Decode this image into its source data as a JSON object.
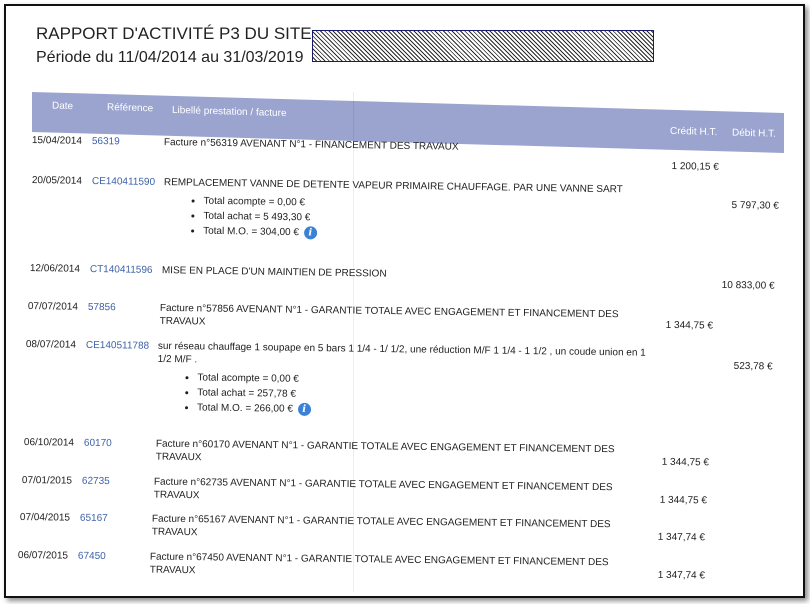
{
  "report": {
    "title": "RAPPORT D'ACTIVITÉ P3 DU SITE",
    "period": "Période du 11/04/2014 au 31/03/2019"
  },
  "columns": {
    "date": "Date",
    "reference": "Référence",
    "libelle": "Libellé prestation / facture",
    "credit": "Crédit H.T.",
    "debit": "Débit H.T."
  },
  "rows": [
    {
      "date": "15/04/2014",
      "ref": "56319",
      "desc": "Facture n°56319 AVENANT N°1 - FINANCEMENT DES TRAVAUX",
      "credit": "1 200,15 €",
      "debit": ""
    },
    {
      "date": "20/05/2014",
      "ref": "CE140411590",
      "desc": "REMPLACEMENT VANNE DE DETENTE VAPEUR PRIMAIRE CHAUFFAGE. PAR UNE VANNE SART",
      "credit": "",
      "debit": "5 797,30 €",
      "totals": [
        "Total acompte = 0,00 €",
        "Total achat = 5 493,30 €",
        "Total M.O. = 304,00 €"
      ]
    },
    {
      "date": "12/06/2014",
      "ref": "CT140411596",
      "desc": "MISE EN PLACE D'UN MAINTIEN DE PRESSION",
      "credit": "",
      "debit": "10 833,00 €"
    },
    {
      "date": "07/07/2014",
      "ref": "57856",
      "desc": "Facture n°57856 AVENANT N°1 - GARANTIE TOTALE AVEC ENGAGEMENT ET FINANCEMENT DES TRAVAUX",
      "credit": "1 344,75 €",
      "debit": ""
    },
    {
      "date": "08/07/2014",
      "ref": "CE140511788",
      "desc": "sur réseau chauffage 1 soupape en 5 bars 1 1/4 - 1/ 1/2, une réduction M/F 1 1/4 - 1 1/2 , un coude union en 1 1/2 M/F .",
      "credit": "",
      "debit": "523,78 €",
      "totals": [
        "Total acompte = 0,00 €",
        "Total achat = 257,78 €",
        "Total M.O. = 266,00 €"
      ]
    },
    {
      "date": "06/10/2014",
      "ref": "60170",
      "desc": "Facture n°60170 AVENANT N°1 - GARANTIE TOTALE AVEC ENGAGEMENT ET FINANCEMENT DES TRAVAUX",
      "credit": "1 344,75 €",
      "debit": ""
    },
    {
      "date": "07/01/2015",
      "ref": "62735",
      "desc": "Facture n°62735 AVENANT N°1 - GARANTIE TOTALE AVEC ENGAGEMENT ET FINANCEMENT DES TRAVAUX",
      "credit": "1 344,75 €",
      "debit": ""
    },
    {
      "date": "07/04/2015",
      "ref": "65167",
      "desc": "Facture n°65167 AVENANT N°1 - GARANTIE TOTALE AVEC ENGAGEMENT ET FINANCEMENT DES TRAVAUX",
      "credit": "1 347,74 €",
      "debit": ""
    },
    {
      "date": "06/07/2015",
      "ref": "67450",
      "desc": "Facture n°67450 AVENANT N°1 - GARANTIE TOTALE AVEC ENGAGEMENT ET FINANCEMENT DES TRAVAUX",
      "credit": "1 347,74 €",
      "debit": ""
    }
  ],
  "icons": {
    "totals_info": "info-icon"
  },
  "colors": {
    "header_band": "#9aa4cf",
    "reference_link": "#3f63a8",
    "info_icon": "#3b82d6"
  }
}
